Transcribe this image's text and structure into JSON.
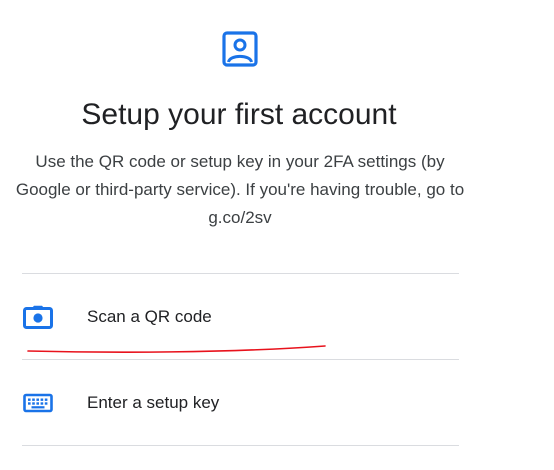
{
  "header": {
    "icon": "account-box-icon",
    "title": "Setup your first account",
    "description": "Use the QR code or setup key in your 2FA settings (by Google or third-party service). If you're having trouble, go to g.co/2sv"
  },
  "options": [
    {
      "icon": "camera-icon",
      "label": "Scan a QR code"
    },
    {
      "icon": "keyboard-icon",
      "label": "Enter a setup key"
    }
  ],
  "colors": {
    "accent": "#1a73e8",
    "divider": "#dadce0",
    "annotation": "#e8121c"
  }
}
